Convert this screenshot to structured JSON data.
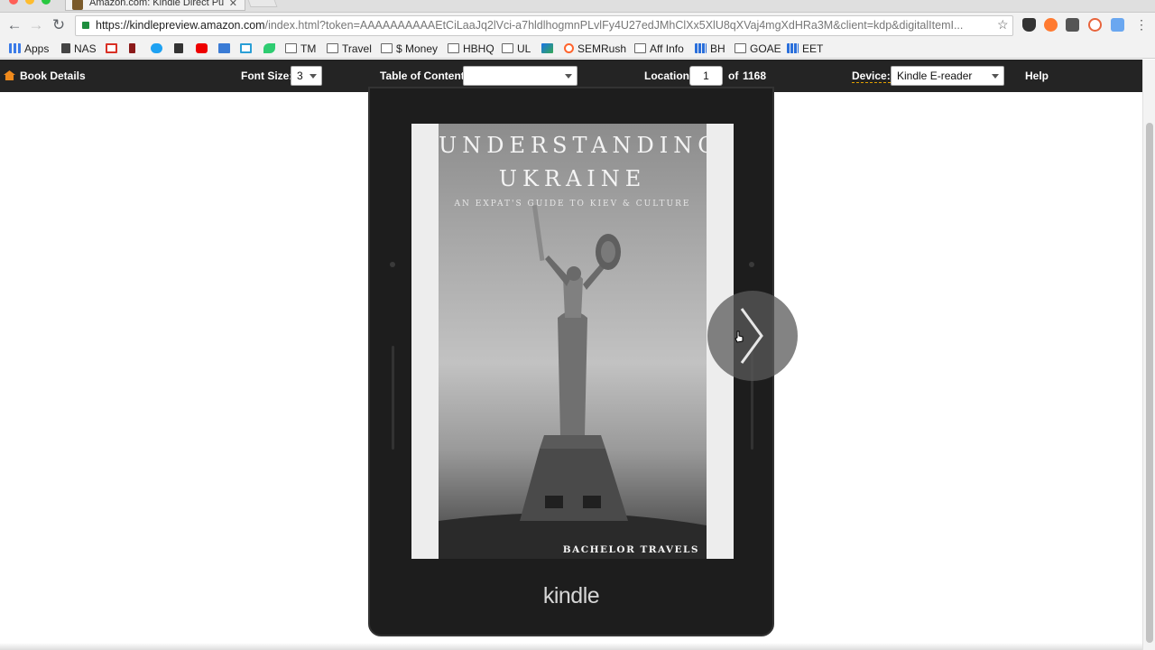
{
  "browser": {
    "tab_title": "Amazon.com: Kindle Direct Pu",
    "url_host": "https://kindlepreview.amazon.com",
    "url_path": "/index.html?token=AAAAAAAAAAEtCiLaaJq2lVci-a7hldlhogmnPLvlFy4U27edJMhClXx5XlU8qXVaj4mgXdHRa3M&client=kdp&digitalItemI...",
    "bookmarks": [
      {
        "label": "Apps",
        "icon": "apps-grid-icon"
      },
      {
        "label": "NAS",
        "icon": "nas-icon"
      },
      {
        "label": "",
        "icon": "gmail-icon"
      },
      {
        "label": "",
        "icon": "pin-icon"
      },
      {
        "label": "",
        "icon": "twitter-icon"
      },
      {
        "label": "",
        "icon": "bookmark-icon"
      },
      {
        "label": "",
        "icon": "youtube-icon"
      },
      {
        "label": "",
        "icon": "layers-icon"
      },
      {
        "label": "",
        "icon": "bracket-icon"
      },
      {
        "label": "",
        "icon": "leaf-icon"
      },
      {
        "label": "TM",
        "icon": "folder-icon"
      },
      {
        "label": "Travel",
        "icon": "folder-icon"
      },
      {
        "label": "$ Money",
        "icon": "folder-icon"
      },
      {
        "label": "HBHQ",
        "icon": "folder-icon"
      },
      {
        "label": "UL",
        "icon": "folder-icon"
      },
      {
        "label": "",
        "icon": "a-logo-icon"
      },
      {
        "label": "SEMRush",
        "icon": "semrush-icon"
      },
      {
        "label": "Aff Info",
        "icon": "folder-icon"
      },
      {
        "label": "BH",
        "icon": "grid-icon"
      },
      {
        "label": "GOAE",
        "icon": "folder-icon"
      },
      {
        "label": "EET",
        "icon": "grid-icon"
      }
    ]
  },
  "kdp_toolbar": {
    "book_details": "Book Details",
    "font_size_label": "Font Size:",
    "font_size_value": "3",
    "toc_label": "Table of Contents:",
    "toc_value": "",
    "location_label": "Location:",
    "location_value": "1",
    "of_label": "of",
    "location_total": "1168",
    "device_label": "Device:",
    "device_value": "Kindle E-reader",
    "help": "Help"
  },
  "book_cover": {
    "title_line1": "UNDERSTANDING",
    "title_line2": "UKRAINE",
    "subtitle": "AN EXPAT'S GUIDE TO KIEV & CULTURE",
    "author": "BACHELOR TRAVELS"
  },
  "device": {
    "brand_logo": "kindle"
  },
  "colors": {
    "toolbar_bg": "#242424",
    "device_bg": "#1d1d1d",
    "accent_orange": "#f08a1c"
  }
}
